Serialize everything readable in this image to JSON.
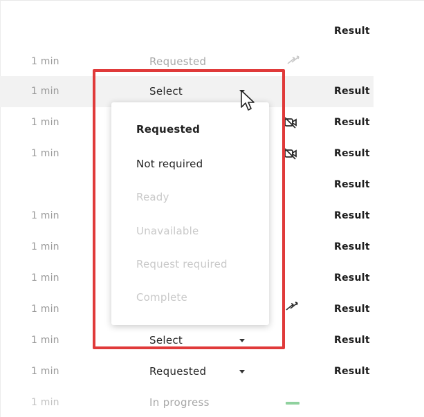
{
  "header": {
    "result_label": "Result"
  },
  "rows": [
    {
      "time": "1 min",
      "status": "Requested",
      "result": ""
    },
    {
      "time": "1 min",
      "status": "Select",
      "result": "Result"
    },
    {
      "time": "1 min",
      "status": "",
      "result": "Result"
    },
    {
      "time": "1 min",
      "status": "",
      "result": "Result"
    },
    {
      "time": "",
      "status": "",
      "result": "Result"
    },
    {
      "time": "1 min",
      "status": "",
      "result": "Result"
    },
    {
      "time": "1 min",
      "status": "",
      "result": "Result"
    },
    {
      "time": "1 min",
      "status": "",
      "result": "Result"
    },
    {
      "time": "1 min",
      "status": "",
      "result": "Result"
    },
    {
      "time": "1 min",
      "status": "Select",
      "result": "Result"
    },
    {
      "time": "1 min",
      "status": "Requested",
      "result": "Result"
    },
    {
      "time": "1 min",
      "status": "In progress",
      "result": ""
    }
  ],
  "dropdown": {
    "options": [
      {
        "label": "Requested",
        "state": "selected"
      },
      {
        "label": "Not required",
        "state": "enabled"
      },
      {
        "label": "Ready",
        "state": "disabled"
      },
      {
        "label": "Unavailable",
        "state": "disabled"
      },
      {
        "label": "Request required",
        "state": "disabled"
      },
      {
        "label": "Complete",
        "state": "disabled"
      }
    ]
  },
  "icons": {
    "transfer": "transfer-arrows-icon",
    "video_off": "video-off-icon",
    "progress": "progress-bar-icon",
    "cursor": "mouse-cursor-icon",
    "caret": "chevron-down-icon"
  },
  "colors": {
    "highlight_border": "#e03a3a",
    "progress_green": "#8fd19e",
    "muted_text": "#a8a8a8"
  }
}
